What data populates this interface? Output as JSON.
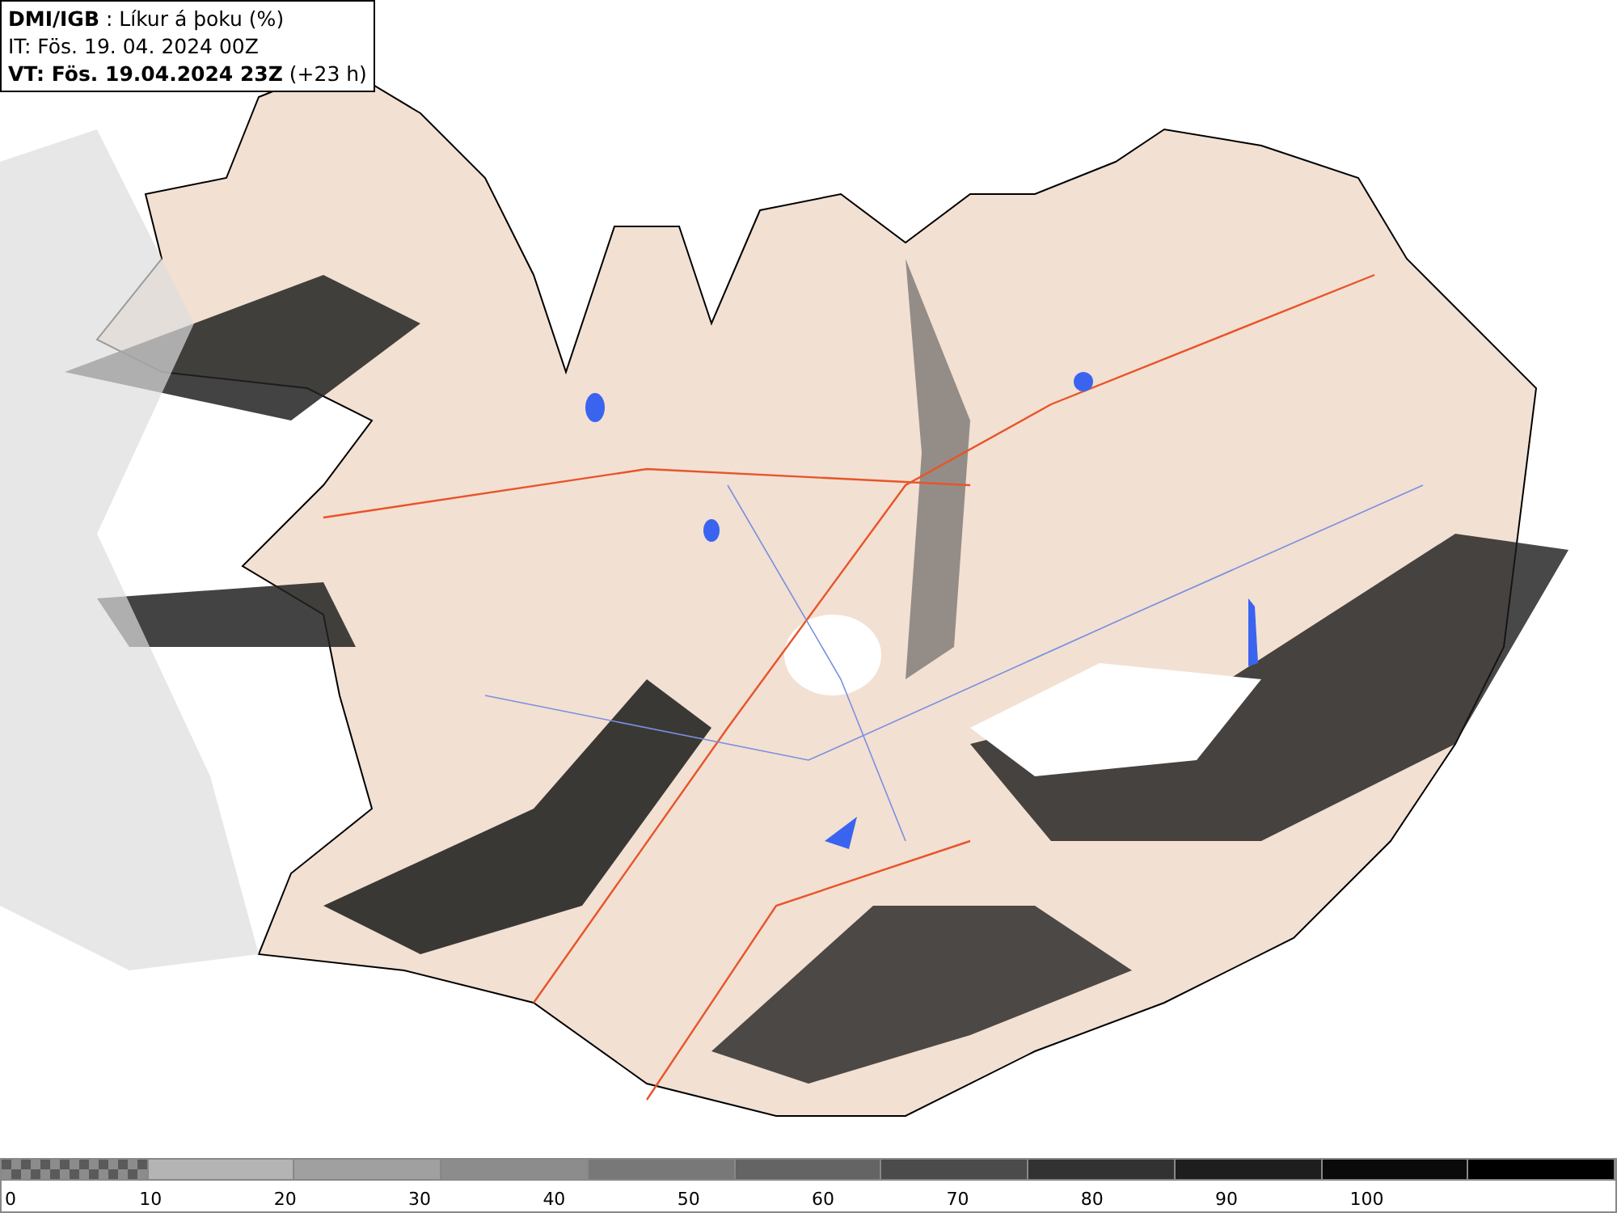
{
  "header": {
    "lines": [
      "**DMI/IGB** : Líkur á þoku (%)",
      "IT: Fös. 19. 04. 2024 00Z",
      "**VT: Fös. 19.04.2024 23Z** (+23 h)"
    ]
  },
  "legend": {
    "bins": [
      {
        "kind": "checker"
      },
      {
        "kind": "solid",
        "color": "#b4b4b4"
      },
      {
        "kind": "solid",
        "color": "#a0a0a0"
      },
      {
        "kind": "solid",
        "color": "#8c8c8c"
      },
      {
        "kind": "solid",
        "color": "#787878"
      },
      {
        "kind": "solid",
        "color": "#646464"
      },
      {
        "kind": "solid",
        "color": "#4b4b4b"
      },
      {
        "kind": "solid",
        "color": "#323232"
      },
      {
        "kind": "solid",
        "color": "#1e1e1e"
      },
      {
        "kind": "solid",
        "color": "#0a0a0a"
      },
      {
        "kind": "solid",
        "color": "#000000"
      }
    ],
    "labels": [
      "0",
      "10",
      "20",
      "30",
      "40",
      "50",
      "60",
      "70",
      "80",
      "90",
      "100"
    ]
  }
}
